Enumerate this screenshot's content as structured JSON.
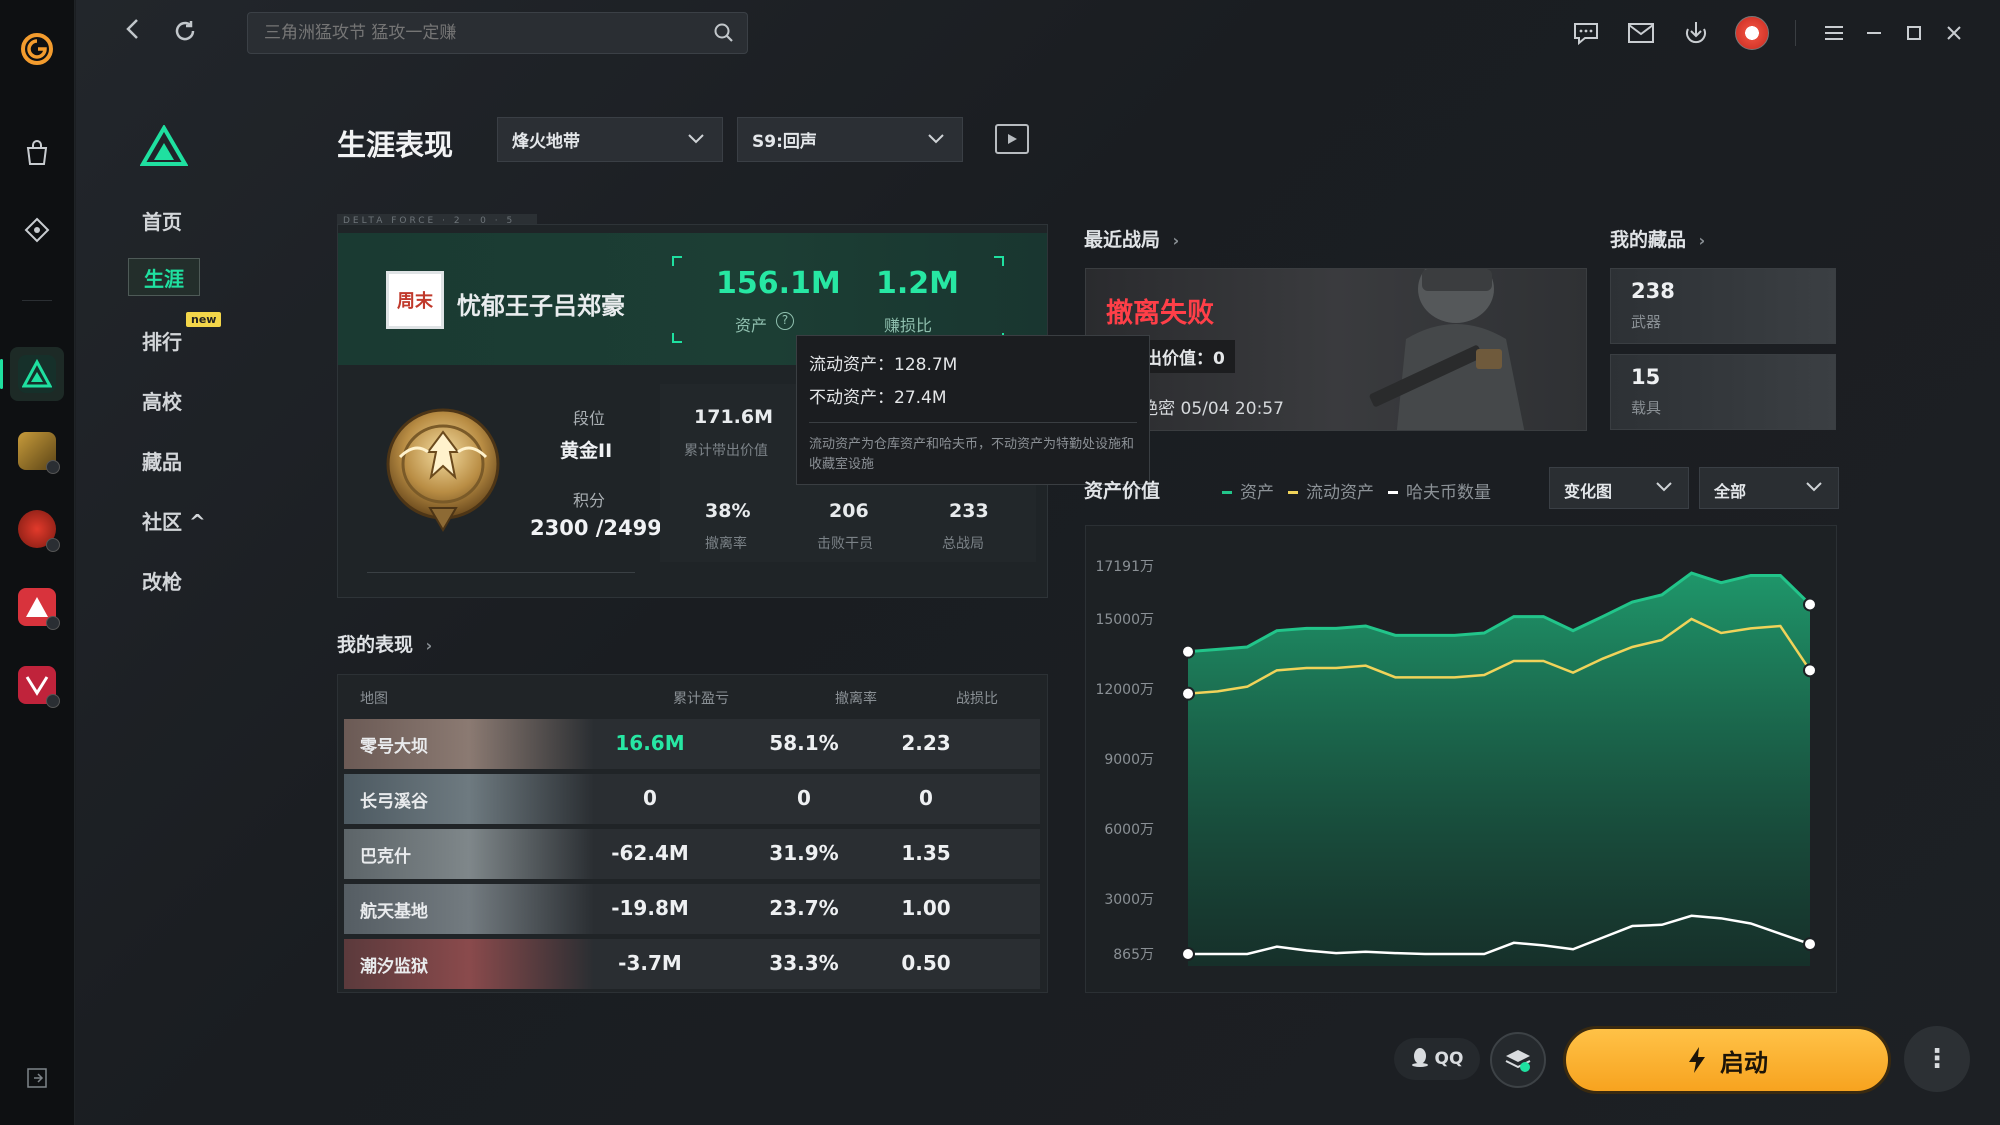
{
  "app": {
    "search_placeholder": "三角洲猛攻节 猛攻一定赚"
  },
  "subnav": {
    "items": [
      {
        "label": "首页"
      },
      {
        "label": "生涯"
      },
      {
        "label": "排行"
      },
      {
        "label": "高校"
      },
      {
        "label": "藏品"
      },
      {
        "label": "社区 ^"
      },
      {
        "label": "改枪"
      }
    ],
    "active_index": 1,
    "new_badge": "new"
  },
  "header": {
    "title": "生涯表现",
    "mode_select": "烽火地带",
    "season_select": "S9:回声"
  },
  "profile": {
    "card_tab": "DELTA FORCE · 2 · 0 · 5",
    "avatar_text": "周末",
    "name": "忧郁王子吕郑豪",
    "assets_value": "156.1M",
    "assets_label": "资产",
    "ratio_value": "1.2M",
    "ratio_label": "赚损比",
    "rank_label": "段位",
    "rank_value": "黄金II",
    "score_label": "积分",
    "score_value": "2300 /2499",
    "stats": [
      {
        "value": "171.6M",
        "label": "累计带出价值"
      },
      {
        "value": "38%",
        "label": "撤离率"
      },
      {
        "value": "206",
        "label": "击败干员"
      },
      {
        "value": "233",
        "label": "总战局"
      }
    ]
  },
  "tooltip": {
    "liquid": "流动资产：128.7M",
    "fixed": "不动资产：27.4M",
    "note": "流动资产为仓库资产和哈夫币，不动资产为特勤处设施和收藏室设施"
  },
  "performance": {
    "title": "我的表现",
    "columns": [
      "地图",
      "累计盈亏",
      "撤离率",
      "战损比"
    ],
    "rows": [
      {
        "map": "零号大坝",
        "profit": "16.6M",
        "extract": "58.1%",
        "kd": "2.23"
      },
      {
        "map": "长弓溪谷",
        "profit": "0",
        "extract": "0",
        "kd": "0"
      },
      {
        "map": "巴克什",
        "profit": "-62.4M",
        "extract": "31.9%",
        "kd": "1.35"
      },
      {
        "map": "航天基地",
        "profit": "-19.8M",
        "extract": "23.7%",
        "kd": "1.00"
      },
      {
        "map": "潮汐监狱",
        "profit": "-3.7M",
        "extract": "33.3%",
        "kd": "0.50"
      }
    ]
  },
  "recent": {
    "title": "最近战局",
    "result": "撤离失败",
    "value_text": "带出价值：0",
    "meta": "…-绝密   05/04 20:57"
  },
  "collection": {
    "title": "我的藏品",
    "weapons_count": "238",
    "weapons_label": "武器",
    "vehicles_count": "15",
    "vehicles_label": "载具"
  },
  "asset_chart": {
    "title": "资产价值",
    "legend": [
      "资产",
      "流动资产",
      "哈夫币数量"
    ],
    "view_select": "变化图",
    "range_select": "全部",
    "colors": {
      "assets": "#22c58a",
      "liquid": "#f0d35a",
      "haf": "#ffffff"
    }
  },
  "chart_data": {
    "type": "area",
    "title": "资产价值",
    "y_ticks": [
      "865万",
      "3000万",
      "6000万",
      "9000万",
      "12000万",
      "15000万",
      "17191万"
    ],
    "y_tick_values": [
      865,
      3000,
      6000,
      9000,
      12000,
      15000,
      17191
    ],
    "ylim": [
      865,
      17191
    ],
    "n_points": 22,
    "series": [
      {
        "name": "资产",
        "values": [
          13600,
          13700,
          13800,
          14500,
          14600,
          14600,
          14700,
          14300,
          14300,
          14300,
          14400,
          15100,
          15100,
          14500,
          15100,
          15700,
          16000,
          16900,
          16500,
          16800,
          16800,
          15600
        ]
      },
      {
        "name": "流动资产",
        "values": [
          11800,
          11900,
          12100,
          12800,
          12900,
          12900,
          13000,
          12500,
          12500,
          12500,
          12600,
          13200,
          13200,
          12700,
          13300,
          13800,
          14100,
          15000,
          14400,
          14600,
          14700,
          12800
        ]
      },
      {
        "name": "哈夫币数量",
        "values": [
          865,
          860,
          700,
          1150,
          1000,
          900,
          950,
          900,
          850,
          700,
          850,
          1300,
          1200,
          1050,
          1500,
          1950,
          2000,
          2350,
          2250,
          2050,
          1650,
          1250
        ]
      }
    ]
  },
  "bottom": {
    "qq_label": "QQ",
    "launch_label": "启动",
    "more_label": "⋮"
  }
}
